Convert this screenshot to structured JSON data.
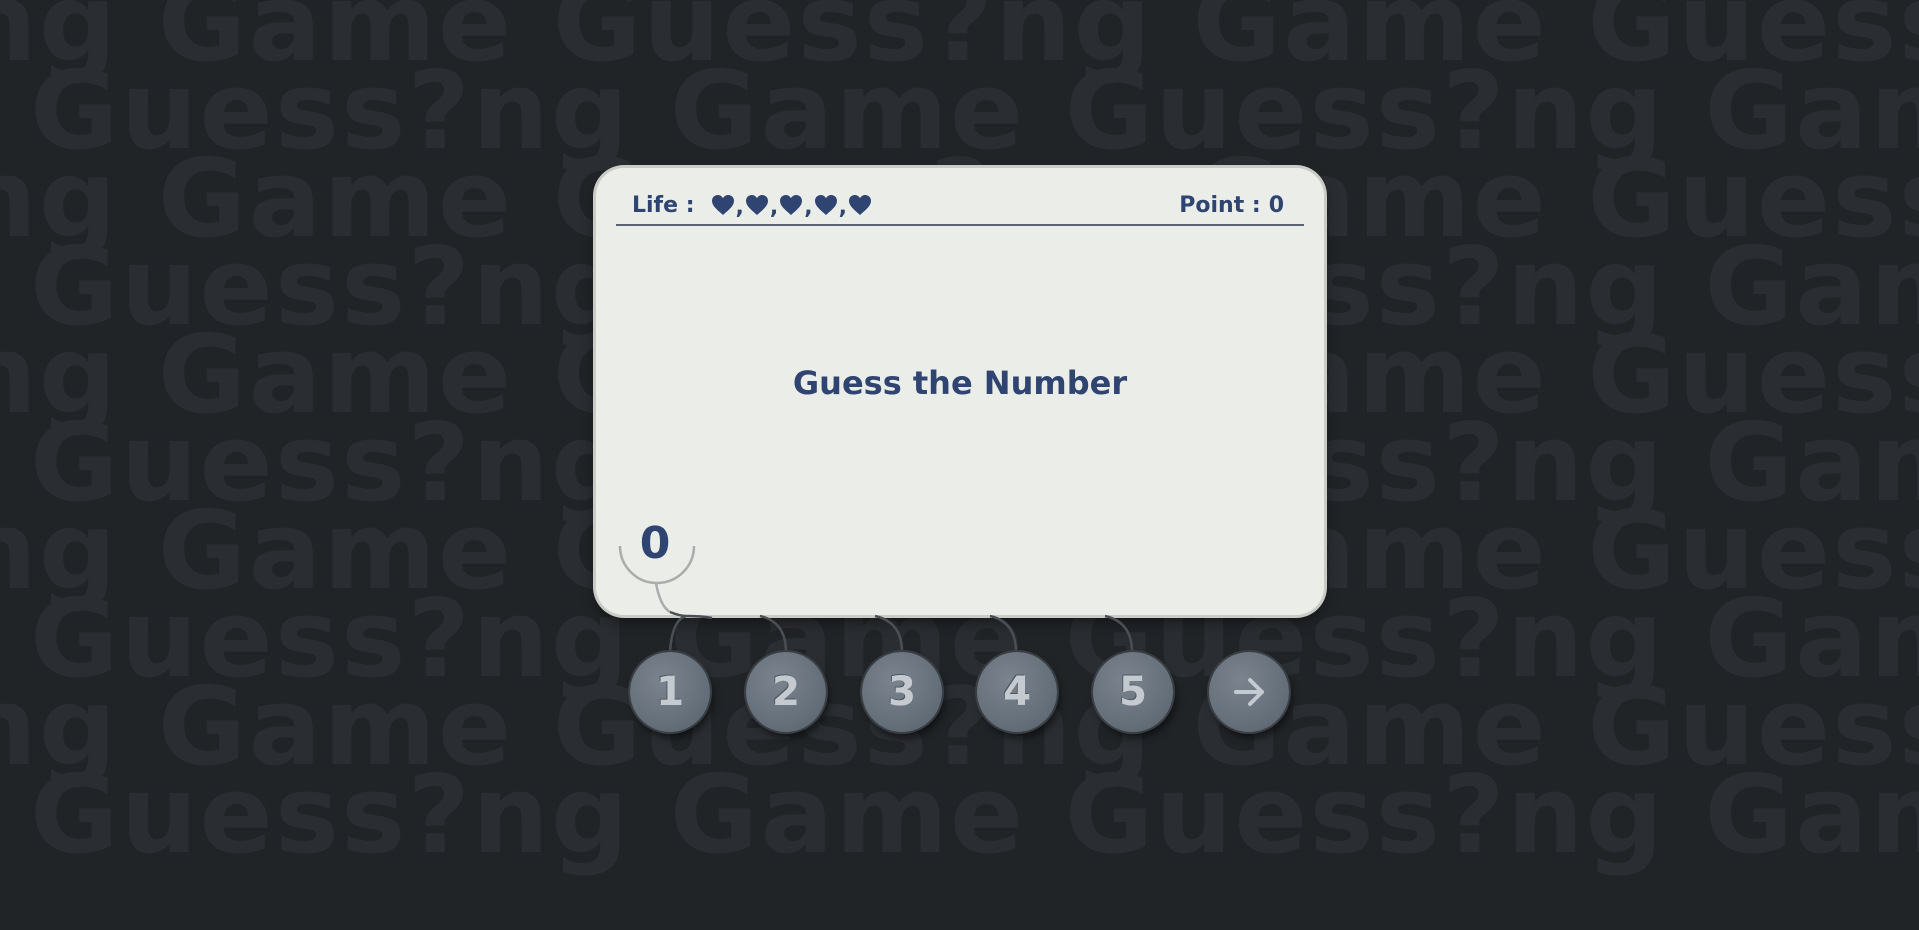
{
  "background": {
    "watermark_lines": [
      "ng Game Guess?ng Game Guess?ng Game",
      "Guess?ng Game   Guess?ng Game Guess?ng",
      "ng Game Guess?ng Game Guess?ng Game",
      "Guess?ng Game   Guess?ng Game Guess?ng",
      "ng Game Guess?ng Game Guess?ng Game",
      "Guess?ng Game   Guess?ng Game Guess?ng",
      "ng Game Guess?ng Game Guess?ng Game",
      "Guess?ng Game   Guess?ng Game Guess?ng",
      "ng Game Guess?ng Game Guess?ng Game",
      "Guess?ng Game   Guess?ng Game Guess?ng"
    ]
  },
  "card": {
    "life_label": "Life :",
    "lives": 5,
    "heart_icon": "heart-icon",
    "heart_separator": ",",
    "point_label": "Point :",
    "point_value": "0",
    "prompt": "Guess the Number",
    "current_guess": "0"
  },
  "buttons": [
    {
      "label": "1",
      "icon": null
    },
    {
      "label": "2",
      "icon": null
    },
    {
      "label": "3",
      "icon": null
    },
    {
      "label": "4",
      "icon": null
    },
    {
      "label": "5",
      "icon": null
    },
    {
      "label": "",
      "icon": "arrow-right-icon"
    }
  ],
  "colors": {
    "background": "#212427",
    "card": "#eaede8",
    "text_primary": "#2f4470",
    "button": "#66707a",
    "button_text": "#c4cad0"
  }
}
